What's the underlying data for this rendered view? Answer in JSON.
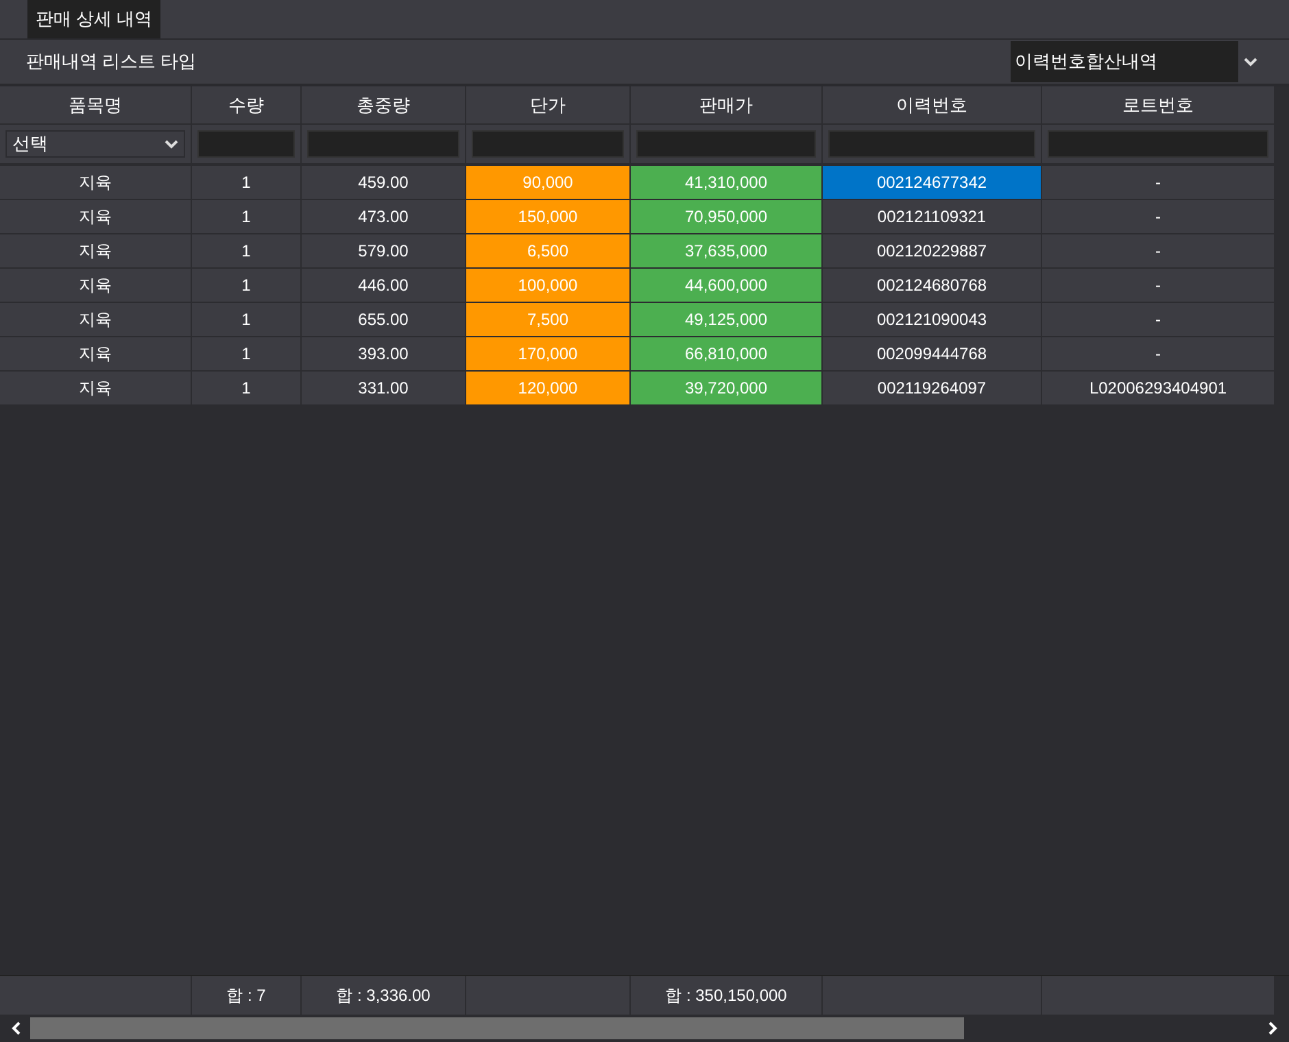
{
  "tabs": [
    {
      "label": "판매 상세 내역",
      "selected": true
    }
  ],
  "toolbar": {
    "label": "판매내역 리스트 타입",
    "dropdown": {
      "value": "이력번호합산내역"
    }
  },
  "table": {
    "columns": [
      {
        "label": "품목명",
        "filter": {
          "kind": "select",
          "value": "선택"
        }
      },
      {
        "label": "수량",
        "filter": {
          "kind": "input"
        },
        "total": "합 : 7"
      },
      {
        "label": "총중량",
        "filter": {
          "kind": "input"
        },
        "total": "합 : 3,336.00"
      },
      {
        "label": "단가",
        "filter": {
          "kind": "input"
        },
        "color": "#ff9800"
      },
      {
        "label": "판매가",
        "filter": {
          "kind": "input"
        },
        "color": "#4caf50",
        "total": "합 : 350,150,000"
      },
      {
        "label": "이력번호",
        "filter": {
          "kind": "input"
        },
        "current": true
      },
      {
        "label": "로트번호",
        "filter": {
          "kind": "input"
        }
      }
    ],
    "rows": [
      {
        "selected": true,
        "cells": [
          "지육",
          "1",
          "459.00",
          "90,000",
          "41,310,000",
          "002124677342",
          "-"
        ]
      },
      {
        "selected": false,
        "cells": [
          "지육",
          "1",
          "473.00",
          "150,000",
          "70,950,000",
          "002121109321",
          "-"
        ]
      },
      {
        "selected": false,
        "cells": [
          "지육",
          "1",
          "579.00",
          "6,500",
          "37,635,000",
          "002120229887",
          "-"
        ]
      },
      {
        "selected": false,
        "cells": [
          "지육",
          "1",
          "446.00",
          "100,000",
          "44,600,000",
          "002124680768",
          "-"
        ]
      },
      {
        "selected": false,
        "cells": [
          "지육",
          "1",
          "655.00",
          "7,500",
          "49,125,000",
          "002121090043",
          "-"
        ]
      },
      {
        "selected": false,
        "cells": [
          "지육",
          "1",
          "393.00",
          "170,000",
          "66,810,000",
          "002099444768",
          "-"
        ]
      },
      {
        "selected": false,
        "cells": [
          "지육",
          "1",
          "331.00",
          "120,000",
          "39,720,000",
          "002119264097",
          "L02006293404901"
        ]
      }
    ]
  }
}
